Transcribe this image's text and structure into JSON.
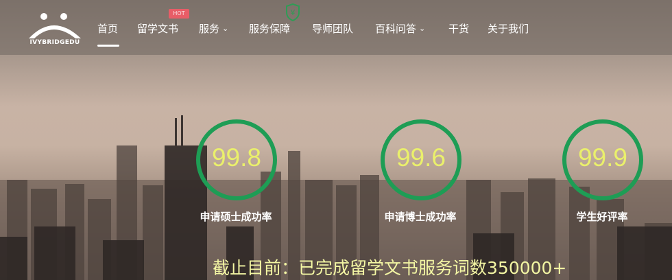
{
  "brand": {
    "logo_text": "IVYBRIDGEDU"
  },
  "nav": {
    "items": [
      {
        "label": "首页",
        "active": true
      },
      {
        "label": "留学文书",
        "badge": "HOT"
      },
      {
        "label": "服务",
        "dropdown": true
      },
      {
        "label": "服务保障",
        "icon": "shield-yuan-icon"
      },
      {
        "label": "导师团队"
      },
      {
        "label": "百科问答",
        "dropdown": true
      },
      {
        "label": "干货"
      },
      {
        "label": "关于我们"
      }
    ]
  },
  "stats": [
    {
      "value": "99.8",
      "label": "申请硕士成功率"
    },
    {
      "value": "99.6",
      "label": "申请博士成功率"
    },
    {
      "value": "99.9",
      "label": "学生好评率"
    }
  ],
  "footer": {
    "text": "截止目前：已完成留学文书服务词数350000+"
  },
  "colors": {
    "ring": "#1e9d55",
    "stat_value": "#eaf06b",
    "hot_badge": "#e85d67"
  }
}
